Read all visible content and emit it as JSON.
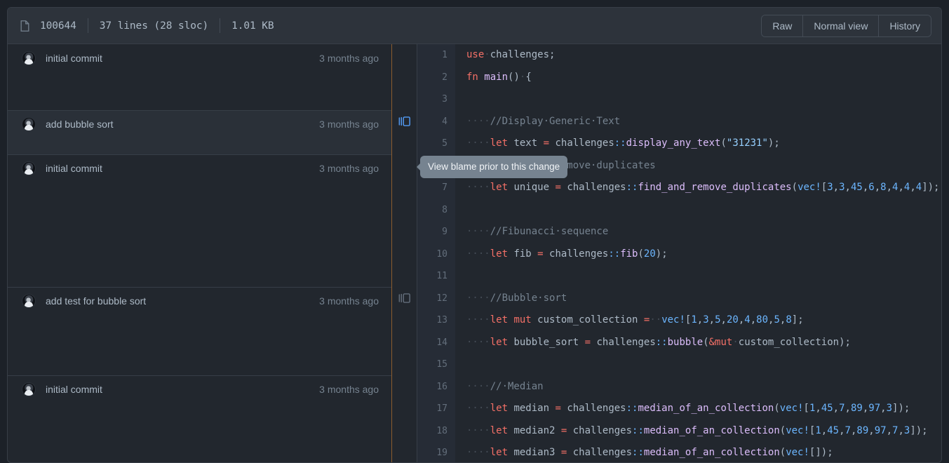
{
  "header": {
    "file_icon": "file-icon",
    "mode": "100644",
    "lines": "37 lines (28 sloc)",
    "size": "1.01 KB",
    "buttons": [
      {
        "label": "Raw",
        "name": "raw-button"
      },
      {
        "label": "Normal view",
        "name": "normal-view-button"
      },
      {
        "label": "History",
        "name": "history-button"
      }
    ]
  },
  "tooltip": {
    "text": "View blame prior to this change"
  },
  "blame_groups": [
    {
      "message": "initial commit",
      "age": "3 months ago",
      "lines": 3,
      "hovered": false,
      "reblame": false
    },
    {
      "message": "add bubble sort",
      "age": "3 months ago",
      "lines": 2,
      "hovered": true,
      "reblame": true
    },
    {
      "message": "initial commit",
      "age": "3 months ago",
      "lines": 6,
      "hovered": false,
      "reblame": false
    },
    {
      "message": "add test for bubble sort",
      "age": "3 months ago",
      "lines": 4,
      "hovered": false,
      "reblame": true
    },
    {
      "message": "initial commit",
      "age": "3 months ago",
      "lines": 4,
      "hovered": false,
      "reblame": false
    }
  ],
  "code": {
    "lines": [
      {
        "n": "1",
        "tokens": [
          {
            "t": "kw",
            "v": "use"
          },
          {
            "t": "ws",
            "v": "·"
          },
          {
            "t": "pun",
            "v": "challenges;"
          }
        ]
      },
      {
        "n": "2",
        "tokens": [
          {
            "t": "kw",
            "v": "fn"
          },
          {
            "t": "pun",
            "v": " "
          },
          {
            "t": "fn",
            "v": "main"
          },
          {
            "t": "pun",
            "v": "()"
          },
          {
            "t": "ws",
            "v": "·"
          },
          {
            "t": "pun",
            "v": "{"
          }
        ]
      },
      {
        "n": "3",
        "tokens": []
      },
      {
        "n": "4",
        "tokens": [
          {
            "t": "ws",
            "v": "····"
          },
          {
            "t": "cmt",
            "v": "//Display·Generic·Text"
          }
        ]
      },
      {
        "n": "5",
        "tokens": [
          {
            "t": "ws",
            "v": "····"
          },
          {
            "t": "kw",
            "v": "let"
          },
          {
            "t": "pun",
            "v": " text "
          },
          {
            "t": "kw",
            "v": "="
          },
          {
            "t": "pun",
            "v": " challenges"
          },
          {
            "t": "mod",
            "v": "::"
          },
          {
            "t": "fn",
            "v": "display_any_text"
          },
          {
            "t": "pun",
            "v": "("
          },
          {
            "t": "str",
            "v": "\"31231\""
          },
          {
            "t": "pun",
            "v": ");"
          }
        ]
      },
      {
        "n": "6",
        "tokens": [
          {
            "t": "ws",
            "v": "····"
          },
          {
            "t": "cmt",
            "v": "//Find·and·Remove·duplicates"
          }
        ]
      },
      {
        "n": "7",
        "tokens": [
          {
            "t": "ws",
            "v": "····"
          },
          {
            "t": "kw",
            "v": "let"
          },
          {
            "t": "pun",
            "v": " unique "
          },
          {
            "t": "kw",
            "v": "="
          },
          {
            "t": "pun",
            "v": " challenges"
          },
          {
            "t": "mod",
            "v": "::"
          },
          {
            "t": "fn",
            "v": "find_and_remove_duplicates"
          },
          {
            "t": "pun",
            "v": "("
          },
          {
            "t": "macro",
            "v": "vec!"
          },
          {
            "t": "pun",
            "v": "["
          },
          {
            "t": "num",
            "v": "3"
          },
          {
            "t": "pun",
            "v": ","
          },
          {
            "t": "num",
            "v": "3"
          },
          {
            "t": "pun",
            "v": ","
          },
          {
            "t": "num",
            "v": "45"
          },
          {
            "t": "pun",
            "v": ","
          },
          {
            "t": "num",
            "v": "6"
          },
          {
            "t": "pun",
            "v": ","
          },
          {
            "t": "num",
            "v": "8"
          },
          {
            "t": "pun",
            "v": ","
          },
          {
            "t": "num",
            "v": "4"
          },
          {
            "t": "pun",
            "v": ","
          },
          {
            "t": "num",
            "v": "4"
          },
          {
            "t": "pun",
            "v": ","
          },
          {
            "t": "num",
            "v": "4"
          },
          {
            "t": "pun",
            "v": "]);"
          }
        ]
      },
      {
        "n": "8",
        "tokens": []
      },
      {
        "n": "9",
        "tokens": [
          {
            "t": "ws",
            "v": "····"
          },
          {
            "t": "cmt",
            "v": "//Fibunacci·sequence"
          }
        ]
      },
      {
        "n": "10",
        "tokens": [
          {
            "t": "ws",
            "v": "····"
          },
          {
            "t": "kw",
            "v": "let"
          },
          {
            "t": "pun",
            "v": " fib "
          },
          {
            "t": "kw",
            "v": "="
          },
          {
            "t": "pun",
            "v": " challenges"
          },
          {
            "t": "mod",
            "v": "::"
          },
          {
            "t": "fn",
            "v": "fib"
          },
          {
            "t": "pun",
            "v": "("
          },
          {
            "t": "num",
            "v": "20"
          },
          {
            "t": "pun",
            "v": ");"
          }
        ]
      },
      {
        "n": "11",
        "tokens": []
      },
      {
        "n": "12",
        "tokens": [
          {
            "t": "ws",
            "v": "····"
          },
          {
            "t": "cmt",
            "v": "//Bubble·sort"
          }
        ]
      },
      {
        "n": "13",
        "tokens": [
          {
            "t": "ws",
            "v": "····"
          },
          {
            "t": "kw",
            "v": "let"
          },
          {
            "t": "pun",
            "v": " "
          },
          {
            "t": "kw",
            "v": "mut"
          },
          {
            "t": "pun",
            "v": " custom_collection "
          },
          {
            "t": "kw",
            "v": "="
          },
          {
            "t": "ws",
            "v": "··"
          },
          {
            "t": "macro",
            "v": "vec!"
          },
          {
            "t": "pun",
            "v": "["
          },
          {
            "t": "num",
            "v": "1"
          },
          {
            "t": "pun",
            "v": ","
          },
          {
            "t": "num",
            "v": "3"
          },
          {
            "t": "pun",
            "v": ","
          },
          {
            "t": "num",
            "v": "5"
          },
          {
            "t": "pun",
            "v": ","
          },
          {
            "t": "num",
            "v": "20"
          },
          {
            "t": "pun",
            "v": ","
          },
          {
            "t": "num",
            "v": "4"
          },
          {
            "t": "pun",
            "v": ","
          },
          {
            "t": "num",
            "v": "80"
          },
          {
            "t": "pun",
            "v": ","
          },
          {
            "t": "num",
            "v": "5"
          },
          {
            "t": "pun",
            "v": ","
          },
          {
            "t": "num",
            "v": "8"
          },
          {
            "t": "pun",
            "v": "];"
          }
        ]
      },
      {
        "n": "14",
        "tokens": [
          {
            "t": "ws",
            "v": "····"
          },
          {
            "t": "kw",
            "v": "let"
          },
          {
            "t": "pun",
            "v": " bubble_sort "
          },
          {
            "t": "kw",
            "v": "="
          },
          {
            "t": "pun",
            "v": " challenges"
          },
          {
            "t": "mod",
            "v": "::"
          },
          {
            "t": "fn",
            "v": "bubble"
          },
          {
            "t": "pun",
            "v": "("
          },
          {
            "t": "kw",
            "v": "&mut"
          },
          {
            "t": "ws",
            "v": "·"
          },
          {
            "t": "pun",
            "v": "custom_collection);"
          }
        ]
      },
      {
        "n": "15",
        "tokens": []
      },
      {
        "n": "16",
        "tokens": [
          {
            "t": "ws",
            "v": "····"
          },
          {
            "t": "cmt",
            "v": "//·Median"
          }
        ]
      },
      {
        "n": "17",
        "tokens": [
          {
            "t": "ws",
            "v": "····"
          },
          {
            "t": "kw",
            "v": "let"
          },
          {
            "t": "pun",
            "v": " median "
          },
          {
            "t": "kw",
            "v": "="
          },
          {
            "t": "pun",
            "v": " challenges"
          },
          {
            "t": "mod",
            "v": "::"
          },
          {
            "t": "fn",
            "v": "median_of_an_collection"
          },
          {
            "t": "pun",
            "v": "("
          },
          {
            "t": "macro",
            "v": "vec!"
          },
          {
            "t": "pun",
            "v": "["
          },
          {
            "t": "num",
            "v": "1"
          },
          {
            "t": "pun",
            "v": ","
          },
          {
            "t": "num",
            "v": "45"
          },
          {
            "t": "pun",
            "v": ","
          },
          {
            "t": "num",
            "v": "7"
          },
          {
            "t": "pun",
            "v": ","
          },
          {
            "t": "num",
            "v": "89"
          },
          {
            "t": "pun",
            "v": ","
          },
          {
            "t": "num",
            "v": "97"
          },
          {
            "t": "pun",
            "v": ","
          },
          {
            "t": "num",
            "v": "3"
          },
          {
            "t": "pun",
            "v": "]);"
          }
        ]
      },
      {
        "n": "18",
        "tokens": [
          {
            "t": "ws",
            "v": "····"
          },
          {
            "t": "kw",
            "v": "let"
          },
          {
            "t": "pun",
            "v": " median2 "
          },
          {
            "t": "kw",
            "v": "="
          },
          {
            "t": "pun",
            "v": " challenges"
          },
          {
            "t": "mod",
            "v": "::"
          },
          {
            "t": "fn",
            "v": "median_of_an_collection"
          },
          {
            "t": "pun",
            "v": "("
          },
          {
            "t": "macro",
            "v": "vec!"
          },
          {
            "t": "pun",
            "v": "["
          },
          {
            "t": "num",
            "v": "1"
          },
          {
            "t": "pun",
            "v": ","
          },
          {
            "t": "num",
            "v": "45"
          },
          {
            "t": "pun",
            "v": ","
          },
          {
            "t": "num",
            "v": "7"
          },
          {
            "t": "pun",
            "v": ","
          },
          {
            "t": "num",
            "v": "89"
          },
          {
            "t": "pun",
            "v": ","
          },
          {
            "t": "num",
            "v": "97"
          },
          {
            "t": "pun",
            "v": ","
          },
          {
            "t": "num",
            "v": "7"
          },
          {
            "t": "pun",
            "v": ","
          },
          {
            "t": "num",
            "v": "3"
          },
          {
            "t": "pun",
            "v": "]);"
          }
        ]
      },
      {
        "n": "19",
        "tokens": [
          {
            "t": "ws",
            "v": "····"
          },
          {
            "t": "kw",
            "v": "let"
          },
          {
            "t": "pun",
            "v": " median3 "
          },
          {
            "t": "kw",
            "v": "="
          },
          {
            "t": "pun",
            "v": " challenges"
          },
          {
            "t": "mod",
            "v": "::"
          },
          {
            "t": "fn",
            "v": "median_of_an_collection"
          },
          {
            "t": "pun",
            "v": "("
          },
          {
            "t": "macro",
            "v": "vec!"
          },
          {
            "t": "pun",
            "v": "[]);"
          }
        ]
      }
    ]
  },
  "colors": {
    "page_bg": "#1c2128",
    "card_bg": "#22272e",
    "header_bg": "#2d333b",
    "border": "#373e47",
    "blame_divider": "#8b5c2e",
    "accent": "#539bf5",
    "muted_text": "#768390",
    "text": "#adbac7"
  }
}
